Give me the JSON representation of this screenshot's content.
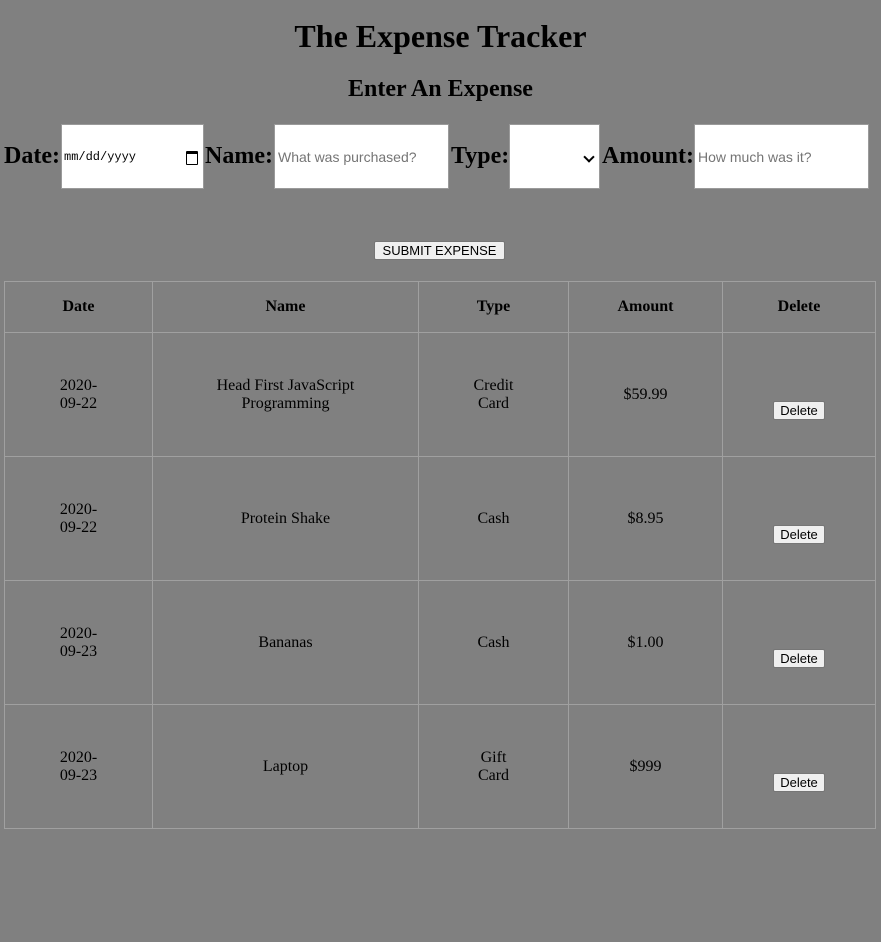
{
  "title": "The Expense Tracker",
  "subtitle": "Enter An Expense",
  "form": {
    "date_label": "Date:",
    "date_value": "mm/dd/yyyy",
    "name_label": "Name:",
    "name_placeholder": "What was purchased?",
    "type_label": "Type:",
    "type_value": "",
    "amount_label": "Amount:",
    "amount_placeholder": "How much was it?",
    "submit_label": "SUBMIT EXPENSE"
  },
  "table": {
    "headers": [
      "Date",
      "Name",
      "Type",
      "Amount",
      "Delete"
    ],
    "rows": [
      {
        "date": "2020-09-22",
        "name": "Head First JavaScript Programming",
        "type": "Credit Card",
        "amount": "$59.99",
        "delete": "Delete"
      },
      {
        "date": "2020-09-22",
        "name": "Protein Shake",
        "type": "Cash",
        "amount": "$8.95",
        "delete": "Delete"
      },
      {
        "date": "2020-09-23",
        "name": "Bananas",
        "type": "Cash",
        "amount": "$1.00",
        "delete": "Delete"
      },
      {
        "date": "2020-09-23",
        "name": "Laptop",
        "type": "Gift Card",
        "amount": "$999",
        "delete": "Delete"
      }
    ]
  },
  "colors": {
    "background": "#808080",
    "input_background": "#ffffff",
    "button_background": "#efefef",
    "border": "#a0a0a0"
  },
  "icons": {
    "date_picker": "calendar-icon",
    "type_select": "chevron-down-icon"
  }
}
